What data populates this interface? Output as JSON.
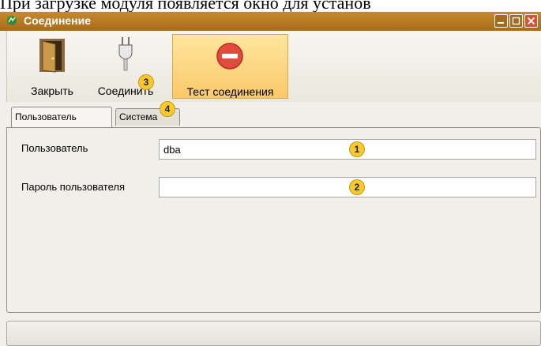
{
  "doc_caption": "При загрузке модуля появляется окно для установ",
  "window": {
    "title": "Соединение",
    "controls": {
      "minimize": "minimize-icon",
      "maximize": "maximize-icon",
      "close": "close-icon"
    }
  },
  "toolbar": {
    "close_label": "Закрыть",
    "connect_label": "Соединить",
    "test_label": "Тест соединения",
    "active_color": "#fcc96a"
  },
  "tabs": {
    "user": "Пользователь",
    "system": "Система"
  },
  "form": {
    "user_label": "Пользователь",
    "user_value": "dba",
    "password_label": "Пароль пользователя",
    "password_value": ""
  },
  "badges": {
    "b1": "1",
    "b2": "2",
    "b3": "3",
    "b4": "4"
  },
  "colors": {
    "titlebar": "#b97a22",
    "badge": "#f8c82f",
    "stop_icon": "#e24a3b"
  }
}
